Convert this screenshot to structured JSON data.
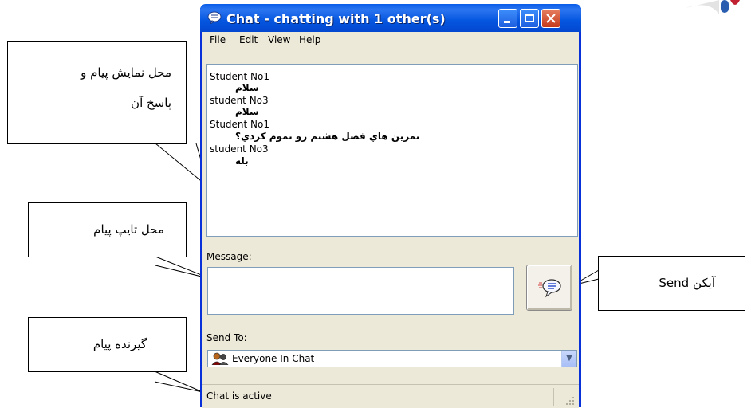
{
  "window": {
    "title": "Chat - chatting with 1 other(s)",
    "menu": [
      "File",
      "Edit",
      "View",
      "Help"
    ],
    "chat_log": [
      {
        "sender": "Student No1",
        "message": "سلام"
      },
      {
        "sender": "student No3",
        "message": "سلام"
      },
      {
        "sender": "Student No1",
        "message": "تمرين هاي فصل هشتم رو تموم كردي؟"
      },
      {
        "sender": "student No3",
        "message": "بله"
      }
    ],
    "message_label": "Message:",
    "message_value": "",
    "send_to_label": "Send To:",
    "send_to_selected": "Everyone In Chat",
    "status": "Chat is active"
  },
  "callouts": {
    "display_area": [
      "محل نمایش پیام و",
      "پاسخ آن"
    ],
    "type_area": "محل تایپ پیام",
    "send_icon": "آیکن Send",
    "recipient": "گیرنده پیام"
  },
  "icons": {
    "title": "chat-bubble-icon",
    "send": "send-speech-bubble-icon",
    "recipient": "people-icon"
  }
}
